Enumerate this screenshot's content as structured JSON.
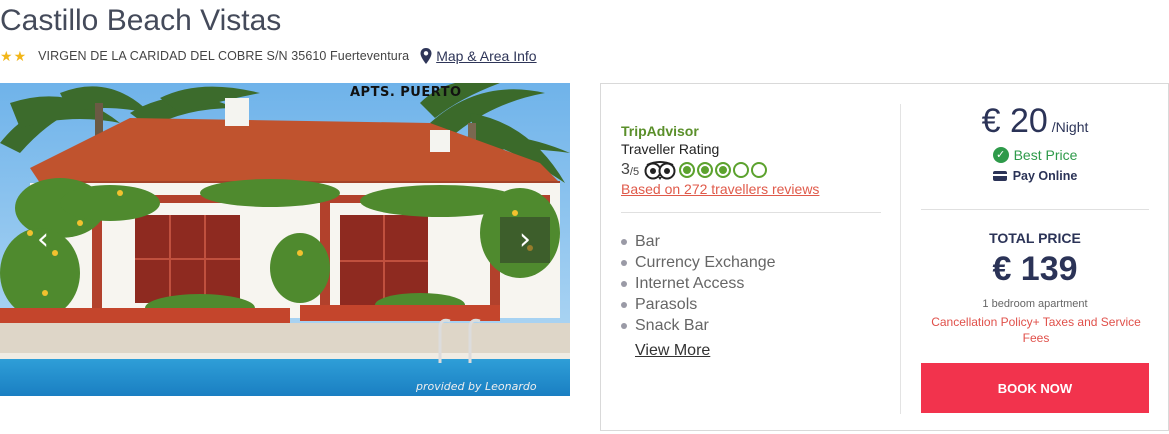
{
  "hotel": {
    "name": "Castillo Beach Vistas",
    "stars": 2,
    "address": "VIRGEN DE LA CARIDAD DEL COBRE S/N 35610 Fuerteventura",
    "map_link": "Map & Area Info"
  },
  "gallery": {
    "sign_text": "APTS. PUERTO",
    "credit": "provided by Leonardo",
    "prev_icon": "chevron-left-icon",
    "next_icon": "chevron-right-icon"
  },
  "tripadvisor": {
    "brand": "TripAdvisor",
    "label": "Traveller Rating",
    "score": "3",
    "out_of": "/5",
    "bubbles_filled": 3,
    "bubbles_total": 5,
    "reviews_link": "Based on 272 travellers reviews"
  },
  "amenities": [
    "Bar",
    "Currency Exchange",
    "Internet Access",
    "Parasols",
    "Snack Bar"
  ],
  "view_more": "View More",
  "pricing": {
    "nightly_price": "€ 20",
    "nightly_unit": "/Night",
    "best_price": "Best Price",
    "pay_online": "Pay Online",
    "total_label": "TOTAL PRICE",
    "total_price": "€ 139",
    "room_type": "1 bedroom apartment",
    "cancellation": "Cancellation Policy+ Taxes and Service Fees",
    "book_button": "BOOK NOW"
  },
  "colors": {
    "brand_navy": "#2b3357",
    "accent_red": "#f2334d",
    "tripadvisor_green": "#5ca22e",
    "best_price_green": "#2e9a4a",
    "star_yellow": "#f2b619"
  }
}
